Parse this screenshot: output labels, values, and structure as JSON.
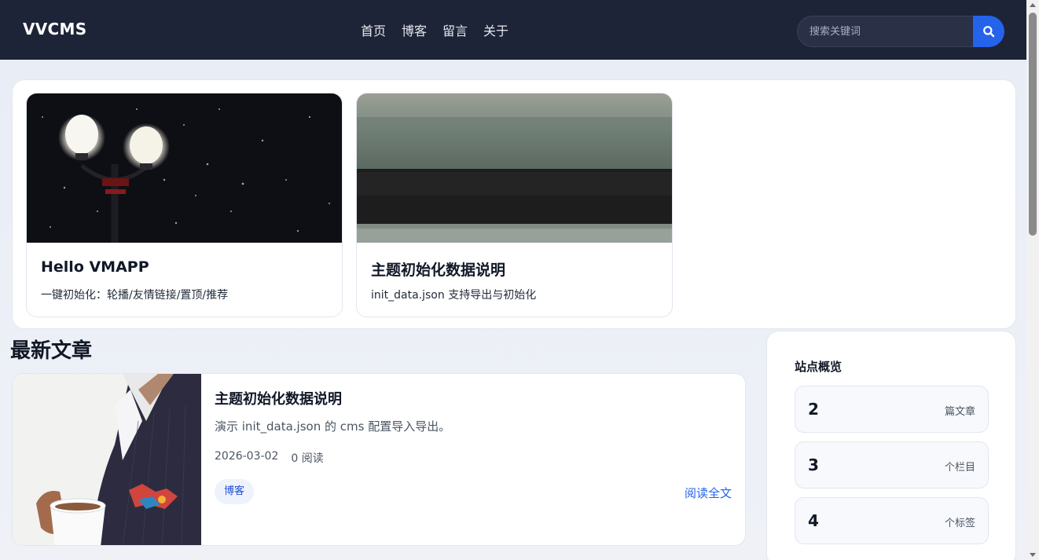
{
  "header": {
    "brand": "VVCMS",
    "nav": [
      "首页",
      "博客",
      "留言",
      "关于"
    ],
    "search_placeholder": "搜索关键词",
    "search_icon": "search-icon",
    "accent_color": "#2563eb",
    "background_color": "#1e2438"
  },
  "carousel": {
    "slides": [
      {
        "title": "Hello VMAPP",
        "desc": "一键初始化：轮播/友情链接/置顶/推荐",
        "image": "night-street-lamps-image"
      },
      {
        "title": "主题初始化数据说明",
        "desc": "init_data.json 支持导出与初始化",
        "image": "frosty-field-image"
      }
    ]
  },
  "main": {
    "section_title": "最新文章",
    "articles": [
      {
        "title": "主题初始化数据说明",
        "desc": "演示 init_data.json 的 cms 配置导入导出。",
        "date": "2026-03-02",
        "views": "0 阅读",
        "tag": "博客",
        "read_more": "阅读全文",
        "image": "man-with-coffee-cup-image"
      }
    ]
  },
  "sidebar": {
    "title": "站点概览",
    "stats": [
      {
        "value": "2",
        "label": "篇文章"
      },
      {
        "value": "3",
        "label": "个栏目"
      },
      {
        "value": "4",
        "label": "个标签"
      }
    ]
  }
}
